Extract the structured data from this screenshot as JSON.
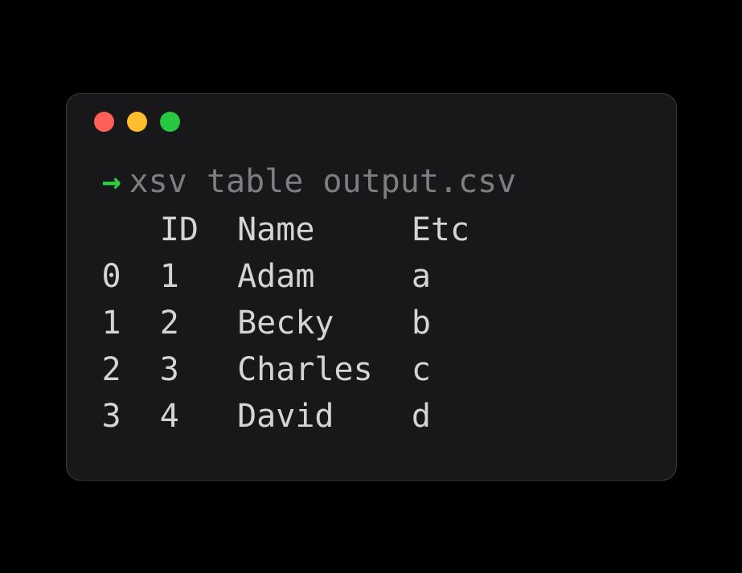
{
  "prompt": {
    "arrow": "→",
    "command": "xsv table output.csv"
  },
  "table": {
    "headers": [
      "",
      "ID",
      "Name",
      "Etc"
    ],
    "rows": [
      [
        "0",
        "1",
        "Adam",
        "a"
      ],
      [
        "1",
        "2",
        "Becky",
        "b"
      ],
      [
        "2",
        "3",
        "Charles",
        "c"
      ],
      [
        "3",
        "4",
        "David",
        "d"
      ]
    ]
  }
}
